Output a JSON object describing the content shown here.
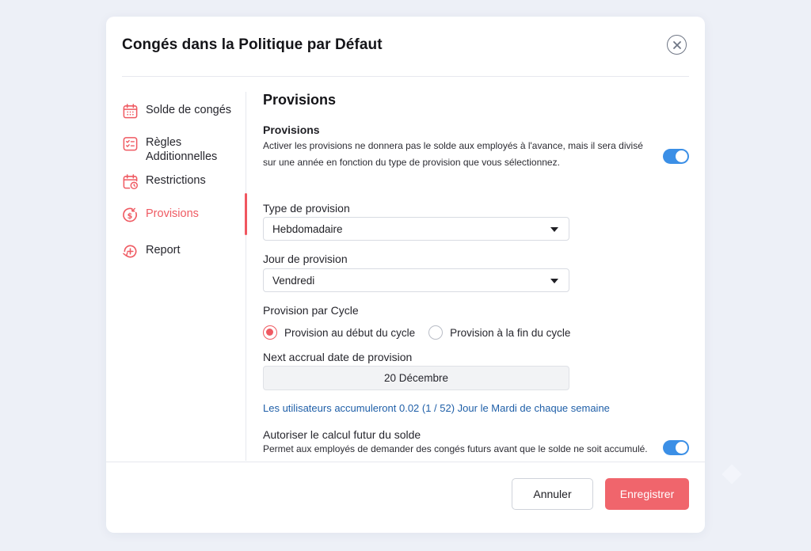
{
  "modal": {
    "title": "Congés dans la Politique par Défaut"
  },
  "sidebar": {
    "items": [
      {
        "label": "Solde de congés",
        "icon": "calendar-grid-icon",
        "active": false
      },
      {
        "label": "Règles Additionnelles",
        "icon": "checklist-icon",
        "active": false
      },
      {
        "label": "Restrictions",
        "icon": "calendar-clock-icon",
        "active": false
      },
      {
        "label": "Provisions",
        "icon": "dollar-refresh-icon",
        "active": true
      },
      {
        "label": "Report",
        "icon": "plus-refresh-icon",
        "active": false
      }
    ]
  },
  "main": {
    "section_title": "Provisions",
    "provisions": {
      "label": "Provisions",
      "description_line1": "Activer les provisions ne donnera pas le solde aux employés à l'avance, mais il sera divisé",
      "description_line2": "sur une année en fonction du type de provision que vous sélectionnez.",
      "enabled": true
    },
    "type_provision": {
      "label": "Type de provision",
      "value": "Hebdomadaire"
    },
    "jour_provision": {
      "label": "Jour de provision",
      "value": "Vendredi"
    },
    "cycle": {
      "label": "Provision par Cycle",
      "options": [
        "Provision au début du cycle",
        "Provision à la fin du cycle"
      ],
      "selected": "Provision au début du cycle"
    },
    "next_accrual": {
      "label": "Next accrual date de provision",
      "value": "20 Décembre"
    },
    "info_text": "Les utilisateurs accumuleront 0.02 (1 / 52) Jour le Mardi de chaque semaine",
    "future_calc": {
      "label": "Autoriser le calcul futur du solde",
      "description": "Permet aux employés de demander des congés futurs avant que le solde ne soit accumulé.",
      "enabled": true
    }
  },
  "footer": {
    "cancel_label": "Annuler",
    "save_label": "Enregistrer"
  },
  "colors": {
    "accent": "#ef5a62",
    "toggle": "#3b8fe6",
    "link": "#1f5fa8",
    "background": "#edf0f7"
  }
}
